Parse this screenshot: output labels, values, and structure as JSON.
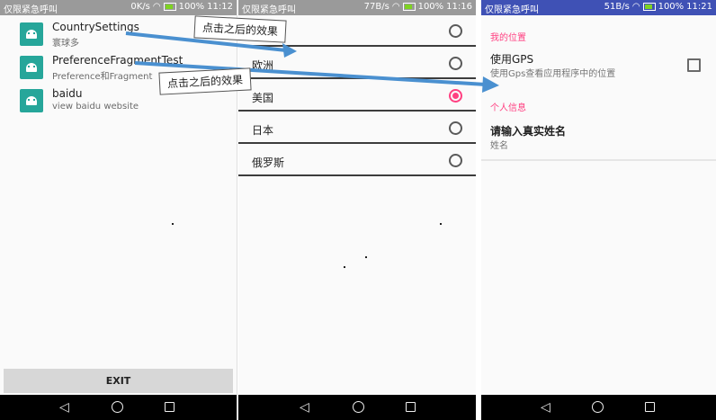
{
  "panel1": {
    "status": {
      "carrier": "仅限紧急呼叫",
      "speed": "0K/s",
      "battery": "100%",
      "time": "11:12"
    },
    "items": [
      {
        "title": "CountrySettings",
        "subtitle": "寰球多"
      },
      {
        "title": "PreferenceFragmentTest",
        "subtitle": "Preference和Fragment"
      },
      {
        "title": "baidu",
        "subtitle": "view baidu website"
      }
    ],
    "exit_label": "EXIT"
  },
  "panel2": {
    "status": {
      "carrier": "仅限紧急呼叫",
      "speed": "77B/s",
      "battery": "100%",
      "time": "11:16"
    },
    "options": [
      {
        "label": "",
        "checked": false
      },
      {
        "label": "欧洲",
        "checked": false
      },
      {
        "label": "美国",
        "checked": true
      },
      {
        "label": "日本",
        "checked": false
      },
      {
        "label": "俄罗斯",
        "checked": false
      }
    ]
  },
  "panel3": {
    "status": {
      "carrier": "仅限紧急呼叫",
      "speed": "51B/s",
      "battery": "100%",
      "time": "11:21"
    },
    "category1": "我的位置",
    "gps_title": "使用GPS",
    "gps_summary": "使用Gps查看应用程序中的位置",
    "category2": "个人信息",
    "name_title": "请输入真实姓名",
    "name_summary": "姓名"
  },
  "annotations": {
    "callout1": "点击之后的效果",
    "callout2": "点击之后的效果"
  },
  "colors": {
    "accent": "#ff4081",
    "primary": "#3f51b5",
    "teal_icon": "#26a69a",
    "arrow": "#4a90d0"
  }
}
